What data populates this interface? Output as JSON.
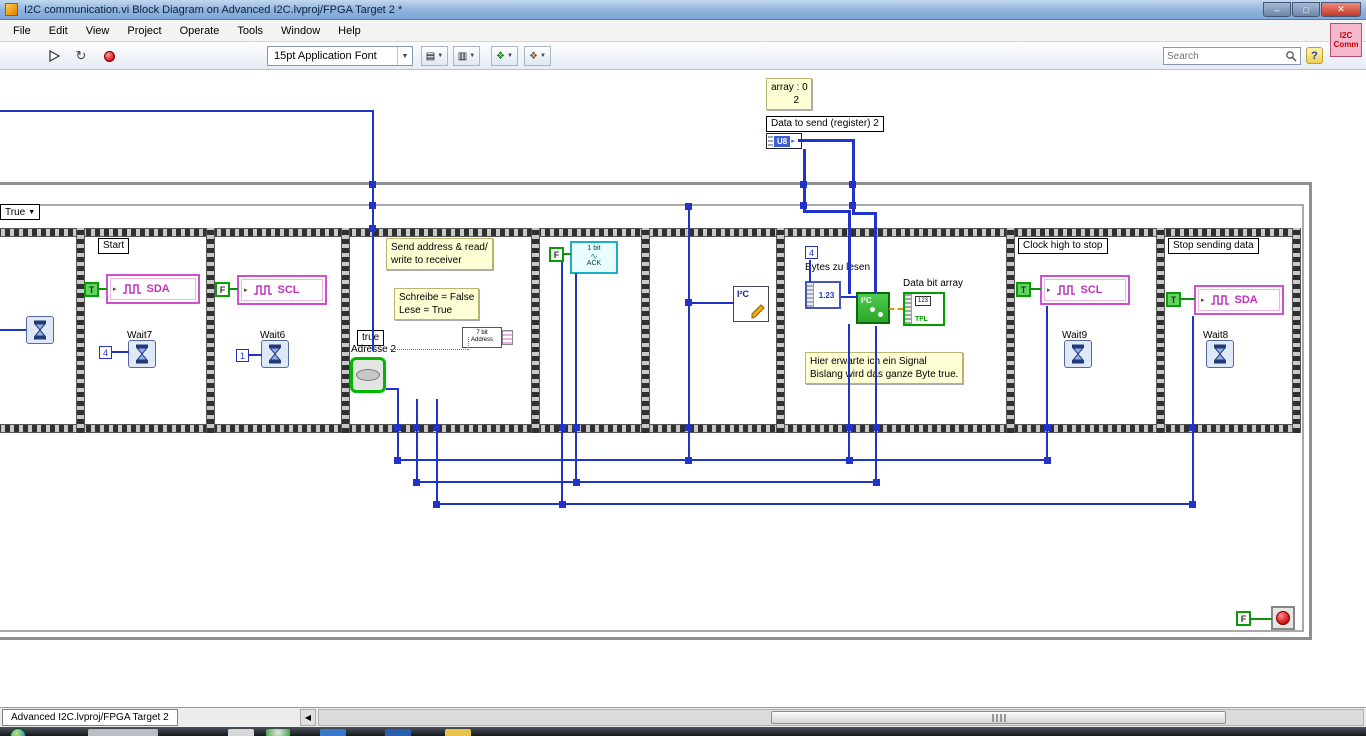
{
  "window": {
    "title": "I2C communication.vi Block Diagram on Advanced I2C.lvproj/FPGA Target 2 *"
  },
  "titlebar_icons": {
    "minimize": "–",
    "maximize": "□",
    "close": "✕"
  },
  "menu": {
    "items": [
      "File",
      "Edit",
      "View",
      "Project",
      "Operate",
      "Tools",
      "Window",
      "Help"
    ]
  },
  "icons": {
    "dropdown": "▼",
    "terminal_arrow": "▸",
    "run_continuous": "↻",
    "align": "▤",
    "distribute": "▥",
    "reorder": "❖"
  },
  "toolbar": {
    "font": "15pt Application Font",
    "search_placeholder": "Search",
    "help": "?"
  },
  "vi_badge": {
    "line1": "I2C",
    "line2": "Comm"
  },
  "diagram": {
    "array_box": {
      "label": "array : 0",
      "value": "2"
    },
    "data_label": "Data to send (register) 2",
    "u8": "U8",
    "case_selector": "True",
    "f1": {
      "start": "Start",
      "bool": "T",
      "wave": "SDA",
      "wait": "Wait7",
      "const": "4"
    },
    "f2": {
      "bool": "F",
      "wave": "SCL",
      "wait": "Wait6",
      "const": "1"
    },
    "f3": {
      "comment1_line1": "Send address & read/",
      "comment1_line2": "write to receiver",
      "comment2_line1": "Schreibe = False",
      "comment2_line2": "Lese = True",
      "true_label": "true",
      "adresse": "Adresse 2",
      "addr_line1": "7 bit",
      "addr_line2": "Address"
    },
    "f4": {
      "bool": "F",
      "ack_line1": "1 bit",
      "ack_line2": "ACK"
    },
    "f5": {
      "i2c": "I²C"
    },
    "f6": {
      "const": "4",
      "bytes": "Bytes zu lesen",
      "num": "1.23",
      "i2c": "I²C",
      "data_bit": "Data bit array",
      "arr_num": "123",
      "arr_type": "TFL",
      "comment_line1": "Hier erwarte ich ein Signal",
      "comment_line2": "Bislang wird das ganze Byte true."
    },
    "f7": {
      "label": "Clock high to stop",
      "bool": "T",
      "wave": "SCL",
      "wait": "Wait9"
    },
    "f8": {
      "label": "Stop sending data",
      "bool": "T",
      "wave": "SDA",
      "wait": "Wait8"
    },
    "loop": {
      "bool": "F"
    }
  },
  "statusbar": {
    "tab": "Advanced I2C.lvproj/FPGA Target 2",
    "nav": "◀"
  },
  "colors": {
    "wire_blue": "#2233cc",
    "bool_green": "#00a000",
    "indicator_pink": "#cf4fcf",
    "comment_yellow": "#ffffd5",
    "structure_gray": "#8f8f8f"
  }
}
